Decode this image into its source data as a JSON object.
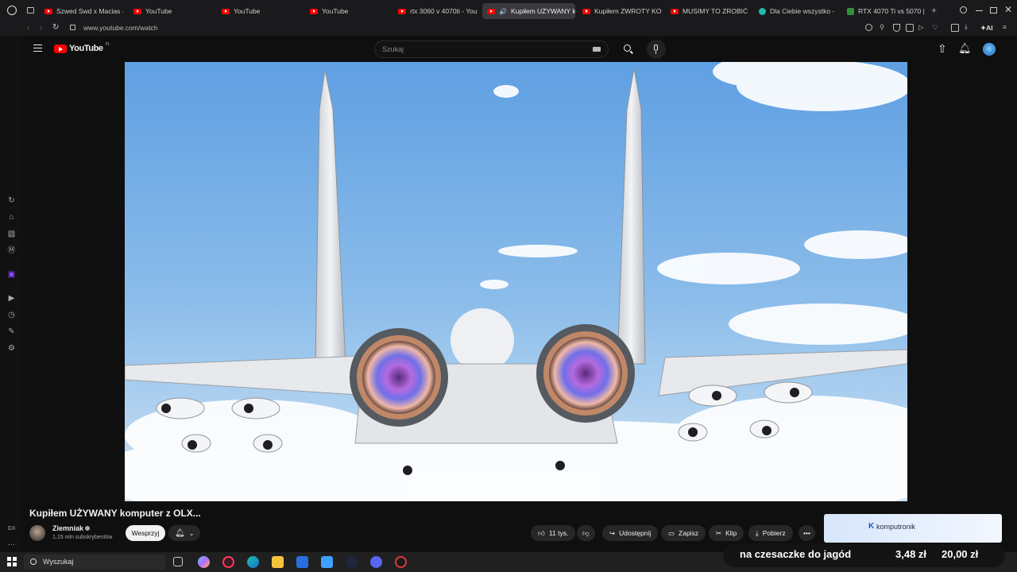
{
  "browser": {
    "tabs": [
      {
        "title": "Szwed Swd x Macias -",
        "icon": "youtube-favicon"
      },
      {
        "title": "YouTube",
        "icon": "youtube-favicon"
      },
      {
        "title": "YouTube",
        "icon": "youtube-favicon"
      },
      {
        "title": "YouTube",
        "icon": "youtube-favicon"
      },
      {
        "title": "rtx 3060 v 4070ti - You",
        "icon": "youtube-favicon"
      },
      {
        "title": "Kupiłem UŻYWANY k",
        "icon": "youtube-favicon",
        "active": true
      },
      {
        "title": "Kupiłem ZWROTY KON",
        "icon": "youtube-favicon"
      },
      {
        "title": "MUSIMY TO ZROBIĆ N",
        "icon": "youtube-favicon"
      },
      {
        "title": "Dla Ciebie wszystko - ",
        "icon": "globe-favicon"
      },
      {
        "title": "RTX 4070 Ti vs 5070 |",
        "icon": "rtx-favicon"
      }
    ],
    "url": "www.youtube.com/watch",
    "ai_label": "AI"
  },
  "youtube": {
    "logo_text": "YouTube",
    "region": "PL",
    "search_placeholder": "Szukaj",
    "video": {
      "title": "Kupiłem UŻYWANY komputer z OLX...",
      "channel": "Ziemniak",
      "subscribers": "1,15 mln subskrybentów",
      "support_label": "Wesprzyj",
      "likes": "11 tys.",
      "share_label": "Udostępnij",
      "save_label": "Zapisz",
      "clip_label": "Klip",
      "download_label": "Pobierz"
    },
    "ad_brand": "komputronik"
  },
  "overlay": {
    "text": "na czesaczke do jagód",
    "price_1": "3,48 zł",
    "price_2": "20,00 zł"
  },
  "taskbar": {
    "search_placeholder": "Wyszukaj"
  },
  "colors": {
    "youtube_red": "#ff0000",
    "background": "#0f0f0f",
    "sky": "#7fb2e6"
  }
}
